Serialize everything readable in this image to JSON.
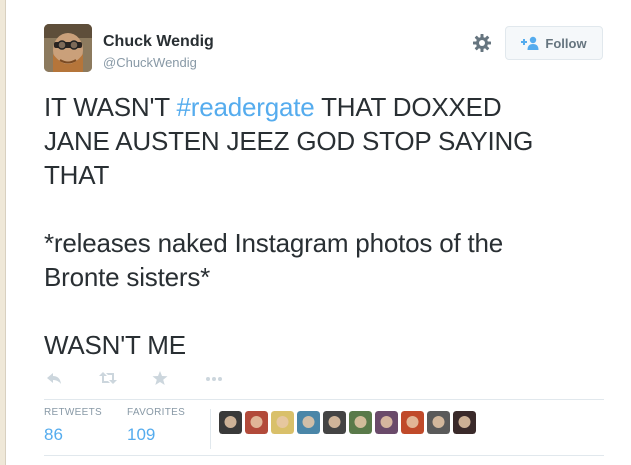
{
  "author": {
    "name": "Chuck Wendig",
    "screen_name": "@ChuckWendig"
  },
  "follow_button": {
    "label": "Follow"
  },
  "tweet": {
    "line1_before": "IT WASN'T ",
    "hashtag": "#readergate",
    "line1_after": " THAT DOXXED",
    "line2": "JANE AUSTEN JEEZ GOD STOP SAYING",
    "line3": "THAT",
    "line4": "*releases naked Instagram photos of the",
    "line5": "Bronte sisters*",
    "line6": "WASN'T ME"
  },
  "stats": {
    "retweets_label": "RETWEETS",
    "retweets_count": "86",
    "favorites_label": "FAVORITES",
    "favorites_count": "109"
  },
  "colors": {
    "link": "#55acee",
    "text": "#292f33",
    "muted": "#8899a6",
    "action_icon": "#ccd6dd"
  },
  "icons": {
    "settings": "gear-icon",
    "follow": "plus-user-icon",
    "actions": [
      "reply-icon",
      "retweet-icon",
      "favorite-icon",
      "more-icon"
    ]
  },
  "favoriter_avatars": [
    {
      "color": "#3a3a3a"
    },
    {
      "color": "#b24a3a"
    },
    {
      "color": "#d9c06a"
    },
    {
      "color": "#4a86a8"
    },
    {
      "color": "#444444"
    },
    {
      "color": "#5a7a4a"
    },
    {
      "color": "#6a4a6a"
    },
    {
      "color": "#c04a2a"
    },
    {
      "color": "#5a5a5a"
    },
    {
      "color": "#3a2a2a"
    }
  ]
}
